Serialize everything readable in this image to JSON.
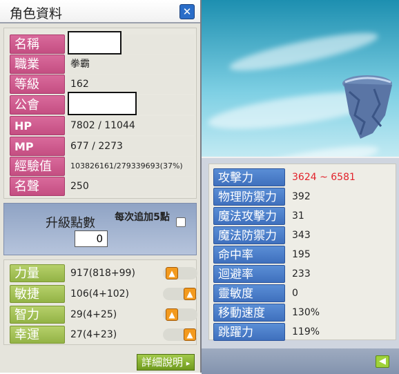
{
  "window": {
    "title": "角色資料",
    "close_icon": "close-icon"
  },
  "character": {
    "rows": [
      {
        "label": "名稱",
        "value": ""
      },
      {
        "label": "職業",
        "value": "拳霸"
      },
      {
        "label": "等級",
        "value": "162"
      },
      {
        "label": "公會",
        "value": ""
      },
      {
        "label": "HP",
        "value": "7802 / 11044"
      },
      {
        "label": "MP",
        "value": "677 / 2273"
      },
      {
        "label": "經驗值",
        "value": "103826161/279339693(37%)"
      },
      {
        "label": "名聲",
        "value": "250"
      }
    ]
  },
  "ability_points": {
    "label": "升級點數",
    "value": "0",
    "auto_label": "每次追加5點"
  },
  "stats": [
    {
      "label": "力量",
      "value": "917(818+99)",
      "toggle": "left"
    },
    {
      "label": "敏捷",
      "value": "106(4+102)",
      "toggle": "right"
    },
    {
      "label": "智力",
      "value": "29(4+25)",
      "toggle": "left"
    },
    {
      "label": "幸運",
      "value": "27(4+23)",
      "toggle": "right"
    }
  ],
  "detail_button": "詳細說明",
  "details": [
    {
      "label": "攻擊力",
      "value": "3624 ~ 6581",
      "highlight": true
    },
    {
      "label": "物理防禦力",
      "value": "392"
    },
    {
      "label": "魔法攻擊力",
      "value": "31"
    },
    {
      "label": "魔法防禦力",
      "value": "343"
    },
    {
      "label": "命中率",
      "value": "195"
    },
    {
      "label": "迴避率",
      "value": "233"
    },
    {
      "label": "靈敏度",
      "value": "0"
    },
    {
      "label": "移動速度",
      "value": "130%"
    },
    {
      "label": "跳躍力",
      "value": "119%"
    }
  ],
  "colors": {
    "info_label": "#c44e82",
    "stat_label": "#93b346",
    "detail_label": "#3f70bd",
    "attack_value": "#e2222b"
  }
}
